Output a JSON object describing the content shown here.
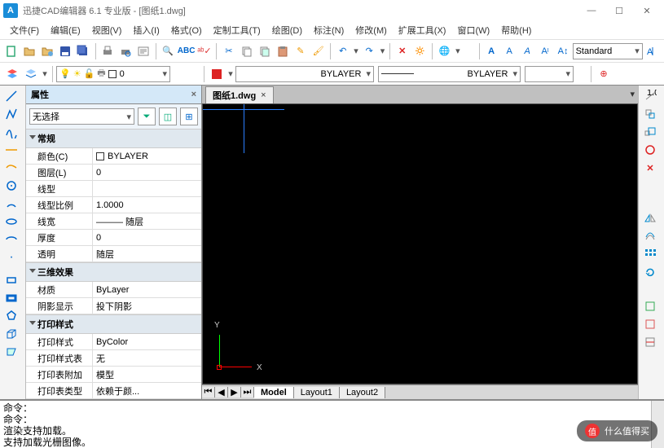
{
  "title": "迅捷CAD编辑器 6.1 专业版  -  [图纸1.dwg]",
  "menu": [
    "文件(F)",
    "编辑(E)",
    "视图(V)",
    "插入(I)",
    "格式(O)",
    "定制工具(T)",
    "绘图(D)",
    "标注(N)",
    "修改(M)",
    "扩展工具(X)",
    "窗口(W)",
    "帮助(H)"
  ],
  "toolbar2": {
    "layer_value": "0",
    "linetype": "BYLAYER",
    "lineweight": "BYLAYER",
    "textstyle": "Standard"
  },
  "properties": {
    "title": "属性",
    "selection": "无选择",
    "groups": [
      {
        "name": "常规",
        "rows": [
          {
            "k": "颜色(C)",
            "v": "BYLAYER",
            "sw": true
          },
          {
            "k": "图层(L)",
            "v": "0"
          },
          {
            "k": "线型",
            "v": ""
          },
          {
            "k": "线型比例",
            "v": "1.0000"
          },
          {
            "k": "线宽",
            "v": "——— 随层"
          },
          {
            "k": "厚度",
            "v": "0"
          },
          {
            "k": "透明",
            "v": "随层"
          }
        ]
      },
      {
        "name": "三维效果",
        "rows": [
          {
            "k": "材质",
            "v": "ByLayer"
          },
          {
            "k": "阴影显示",
            "v": "投下阴影"
          }
        ]
      },
      {
        "name": "打印样式",
        "rows": [
          {
            "k": "打印样式",
            "v": "ByColor"
          },
          {
            "k": "打印样式表",
            "v": "无"
          },
          {
            "k": "打印表附加到",
            "v": "模型"
          },
          {
            "k": "打印表类型",
            "v": "依赖于颜..."
          }
        ]
      }
    ]
  },
  "file_tab": "图纸1.dwg",
  "axes": {
    "x": "X",
    "y": "Y"
  },
  "layouts": {
    "model": "Model",
    "l1": "Layout1",
    "l2": "Layout2"
  },
  "cmd": "命令：\n命令：\n渲染支持加载。\n支持加载光栅图像。",
  "watermark": "什么值得买"
}
